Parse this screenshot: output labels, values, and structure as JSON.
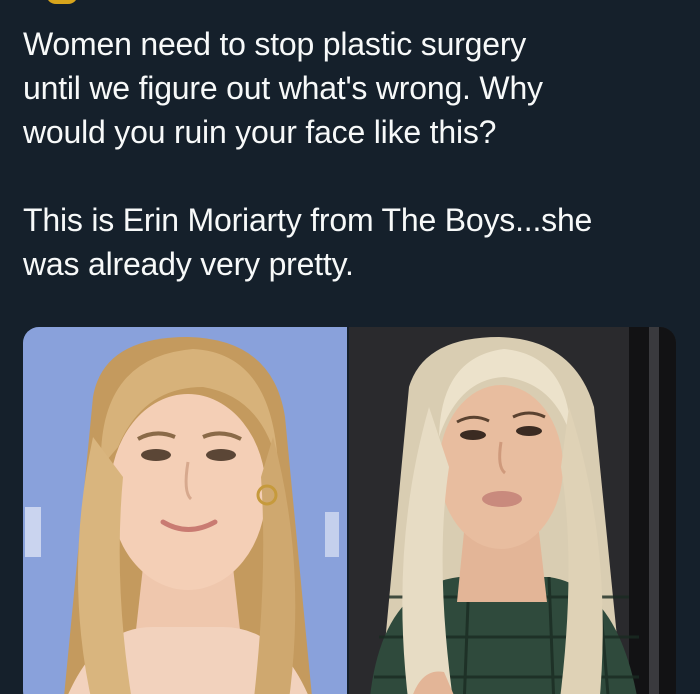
{
  "tweet": {
    "text": "Women need to stop plastic surgery\nuntil we figure out what's wrong. Why\nwould you ruin your face like this?\n\nThis is Erin Moriarty from The Boys...she\nwas already very pretty."
  },
  "media": {
    "images": [
      {
        "name": "before-photo",
        "background_color": "#8fa6dd",
        "hair_color": "#d7b27a"
      },
      {
        "name": "after-photo",
        "background_color": "#2a2a2d",
        "hair_color": "#e7dcc4"
      }
    ]
  },
  "colors": {
    "background": "#15202b",
    "text": "#f7f9f9",
    "avatar": "#d8a51c"
  }
}
